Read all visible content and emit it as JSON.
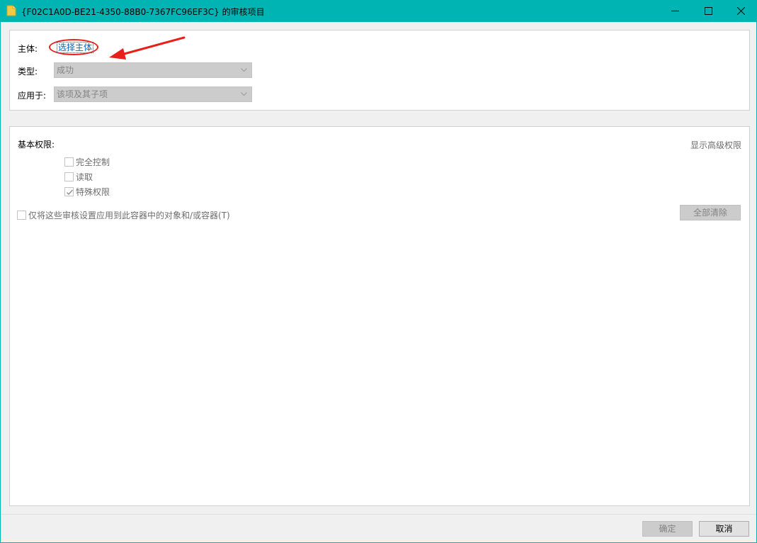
{
  "window": {
    "title": "{F02C1A0D-BE21-4350-88B0-7367FC96EF3C} 的审核项目",
    "icon": "folder-icon",
    "accent_color": "#00b4b4"
  },
  "principal": {
    "label": "主体:",
    "link_text": "选择主体",
    "highlight_color": "#e8201b"
  },
  "type": {
    "label": "类型:",
    "value": "成功"
  },
  "applies_to": {
    "label": "应用于:",
    "value": "该项及其子项"
  },
  "permissions": {
    "label": "基本权限:",
    "show_advanced": "显示高级权限",
    "items": [
      {
        "label": "完全控制",
        "checked": false
      },
      {
        "label": "读取",
        "checked": false
      },
      {
        "label": "特殊权限",
        "checked": true
      }
    ],
    "apply_only_label": "仅将这些审核设置应用到此容器中的对象和/或容器(T)",
    "clear_all": "全部清除"
  },
  "footer": {
    "ok": "确定",
    "cancel": "取消"
  }
}
